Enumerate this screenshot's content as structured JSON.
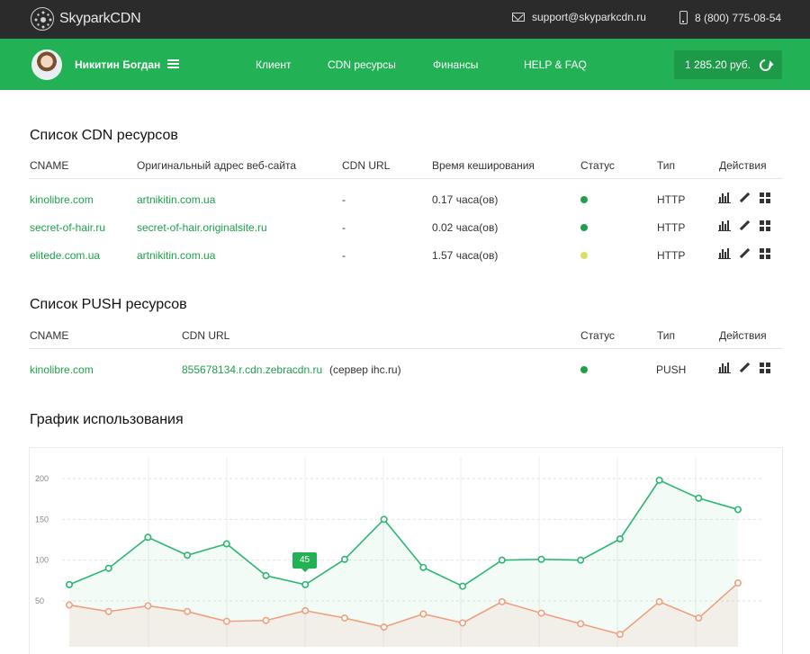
{
  "header": {
    "logo_text": "SkyparkCDN",
    "email": "support@skyparkcdn.ru",
    "phone": "8 (800) 775-08-54"
  },
  "navbar": {
    "user_name": "Никитин Богдан",
    "items": [
      "Клиент",
      "CDN ресурсы",
      "Финансы",
      "HELP & FAQ"
    ],
    "balance": "1 285.20 руб."
  },
  "cdn_section": {
    "title": "Список CDN ресурсов",
    "columns": [
      "CNAME",
      "Оригинальный адрес веб-сайта",
      "CDN URL",
      "Время кеширования",
      "Статус",
      "Тип",
      "Действия"
    ],
    "rows": [
      {
        "cname": "kinolibre.com",
        "origin": "artnikitin.com.ua",
        "cdn_url": "-",
        "cache_time": "0.17 часа(ов)",
        "status_color": "#1ea04a",
        "type": "HTTP"
      },
      {
        "cname": "secret-of-hair.ru",
        "origin": "secret-of-hair.originalsite.ru",
        "cdn_url": "-",
        "cache_time": "0.02 часа(ов)",
        "status_color": "#1ea04a",
        "type": "HTTP"
      },
      {
        "cname": "elitede.com.ua",
        "origin": "artnikitin.com.ua",
        "cdn_url": "-",
        "cache_time": "1.57 часа(ов)",
        "status_color": "#d9e067",
        "type": "HTTP"
      }
    ]
  },
  "push_section": {
    "title": "Список PUSH ресурсов",
    "columns": [
      "CNAME",
      "CDN URL",
      "Статус",
      "Тип",
      "Действия"
    ],
    "rows": [
      {
        "cname": "kinolibre.com",
        "cdn_url": "855678134.r.cdn.zebracdn.ru",
        "server": "(сервер ihc.ru)",
        "status_color": "#1ea04a",
        "type": "PUSH"
      }
    ]
  },
  "usage_section": {
    "title": "График использования"
  },
  "chart_data": {
    "type": "line",
    "y_ticks": [
      "200",
      "150",
      "100",
      "50"
    ],
    "ylim": [
      0,
      200
    ],
    "grid": true,
    "tooltip": "45",
    "series": [
      {
        "color": "#2bb673",
        "values": [
          70,
          90,
          128,
          106,
          120,
          81,
          70,
          101,
          150,
          91,
          68,
          100,
          101,
          100,
          126,
          198,
          176,
          162
        ]
      },
      {
        "color": "#f0a080",
        "values": [
          45,
          37,
          44,
          37,
          25,
          26,
          38,
          29,
          18,
          34,
          23,
          49,
          35,
          22,
          9,
          49,
          29,
          72
        ]
      }
    ],
    "colors": {
      "accent": "#22b255",
      "topbar": "#2b2b2b"
    }
  }
}
